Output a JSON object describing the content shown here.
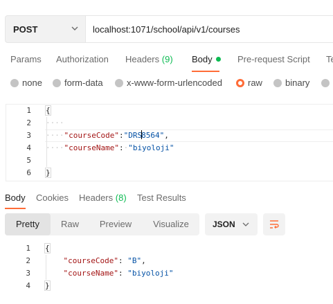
{
  "request": {
    "method": "POST",
    "url": "localhost:1071/school/api/v1/courses"
  },
  "request_tabs": [
    {
      "label": "Params"
    },
    {
      "label": "Authorization"
    },
    {
      "label": "Headers",
      "count": "(9)"
    },
    {
      "label": "Body",
      "active": true
    },
    {
      "label": "Pre-request Script"
    },
    {
      "label": "Te"
    }
  ],
  "body_types": {
    "none": "none",
    "form_data": "form-data",
    "urlencoded": "x-www-form-urlencoded",
    "raw": "raw",
    "binary": "binary",
    "selected": "raw"
  },
  "request_body": {
    "line_numbers": [
      "1",
      "2",
      "3",
      "4",
      "5",
      "6"
    ],
    "open_brace": "{",
    "close_brace": "}",
    "key1": "\"courseCode\"",
    "colon1": ":",
    "value1_a": "\"DRS",
    "value1_b": "8564\"",
    "comma1": ",",
    "key2": "\"courseName\"",
    "colon2": ":",
    "value2": "\"biyoloji\""
  },
  "response_tabs": {
    "body": "Body",
    "cookies": "Cookies",
    "headers": "Headers",
    "headers_count": "(8)",
    "test_results": "Test Results"
  },
  "response_view": {
    "pretty": "Pretty",
    "raw": "Raw",
    "preview": "Preview",
    "visualize": "Visualize",
    "format": "JSON"
  },
  "response_body": {
    "line_numbers": [
      "1",
      "2",
      "3",
      "4"
    ],
    "open_brace": "{",
    "close_brace": "}",
    "key1": "\"courseCode\"",
    "value1": "\"B\"",
    "key2": "\"courseName\"",
    "value2": "\"biyoloji\""
  },
  "colors": {
    "accent": "#ff6c37",
    "success": "#0cbb52",
    "json_key": "#a31515",
    "json_string": "#0451a5"
  },
  "icons": [
    "chevron-down-icon",
    "status-dot-icon",
    "radio-icon",
    "wrap-lines-icon"
  ]
}
